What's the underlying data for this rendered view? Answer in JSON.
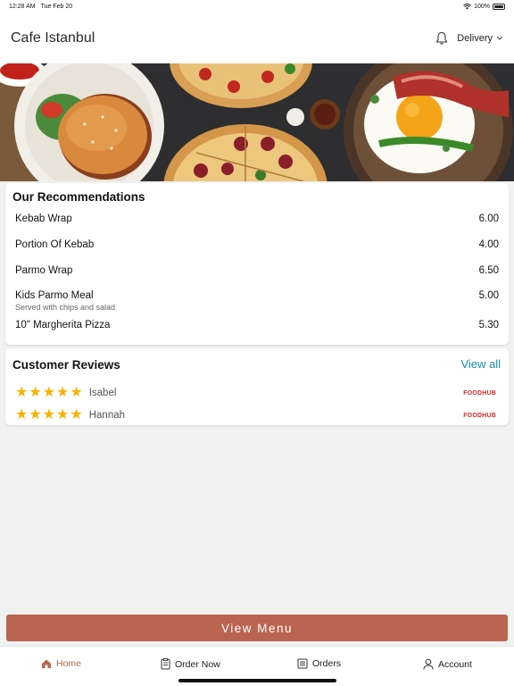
{
  "status_bar": {
    "time": "12:28 AM",
    "date": "Tue Feb 20",
    "battery": "100%"
  },
  "header": {
    "title": "Cafe Istanbul",
    "delivery_label": "Delivery"
  },
  "hero": {
    "description_icon": "food-banner"
  },
  "recommendations": {
    "title": "Our Recommendations",
    "items": [
      {
        "name": "Kebab Wrap",
        "price": "6.00",
        "desc": ""
      },
      {
        "name": "Portion Of Kebab",
        "price": "4.00",
        "desc": ""
      },
      {
        "name": "Parmo Wrap",
        "price": "6.50",
        "desc": ""
      },
      {
        "name": "Kids Parmo Meal",
        "price": "5.00",
        "desc": "Served with chips and salad"
      },
      {
        "name": "10\" Margherita Pizza",
        "price": "5.30",
        "desc": ""
      }
    ]
  },
  "reviews": {
    "title": "Customer Reviews",
    "view_all": "View all",
    "items": [
      {
        "name": "Isabel",
        "rating": 5,
        "source": "FOODHUB"
      },
      {
        "name": "Hannah",
        "rating": 5,
        "source": "FOODHUB"
      }
    ]
  },
  "view_menu_label": "View Menu",
  "tabs": [
    {
      "label": "Home",
      "icon": "home-icon",
      "active": true
    },
    {
      "label": "Order Now",
      "icon": "order-icon",
      "active": false
    },
    {
      "label": "Orders",
      "icon": "orders-icon",
      "active": false
    },
    {
      "label": "Account",
      "icon": "account-icon",
      "active": false
    }
  ],
  "colors": {
    "accent": "#b9654f",
    "link": "#1b8bb3",
    "star": "#f5b400",
    "foodhub": "#d42a2a"
  }
}
